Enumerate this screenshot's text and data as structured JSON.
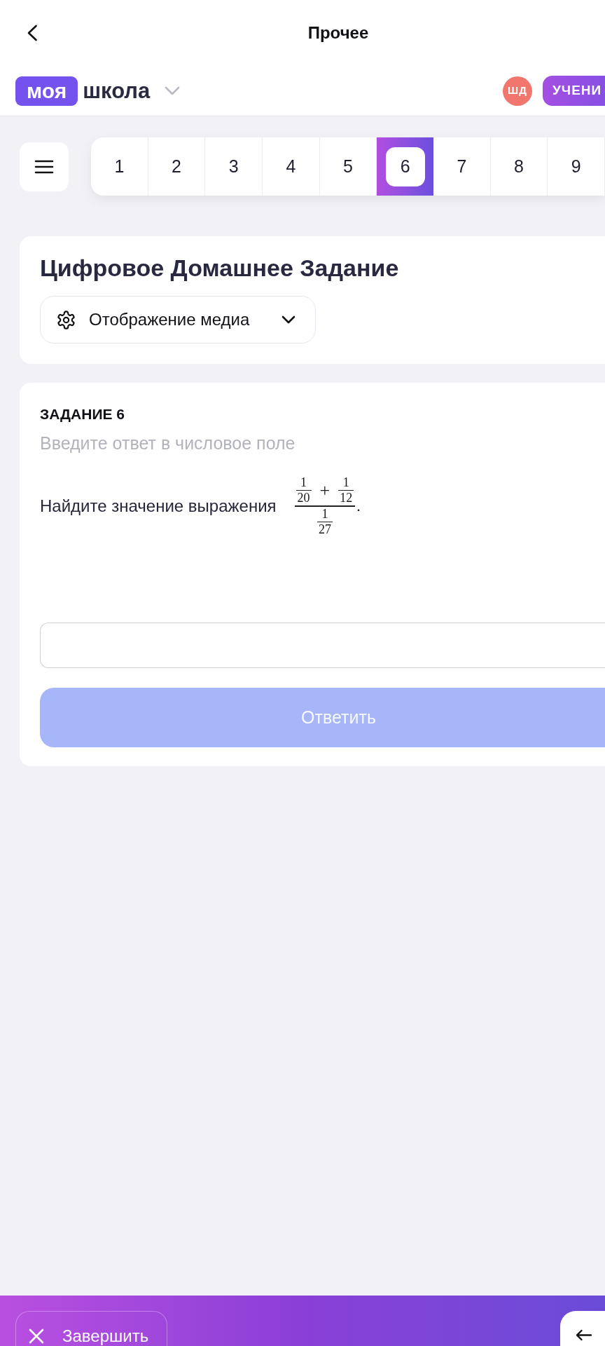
{
  "header": {
    "title": "Прочее"
  },
  "brand": {
    "badge": "моя",
    "name": "школа"
  },
  "user": {
    "initials": "ШД",
    "role": "УЧЕНИ"
  },
  "task_nav": [
    {
      "label": "1",
      "selected": false
    },
    {
      "label": "2",
      "selected": false
    },
    {
      "label": "3",
      "selected": false
    },
    {
      "label": "4",
      "selected": false
    },
    {
      "label": "5",
      "selected": false
    },
    {
      "label": "6",
      "selected": true
    },
    {
      "label": "7",
      "selected": false
    },
    {
      "label": "8",
      "selected": false
    },
    {
      "label": "9",
      "selected": false
    }
  ],
  "homework": {
    "title": "Цифровое Домашнее Задание",
    "media_dropdown": {
      "label": "Отображение медиа"
    }
  },
  "task": {
    "heading": "ЗАДАНИЕ 6",
    "instruction": "Введите ответ в числовое поле",
    "question": "Найдите значение выражения",
    "expression": {
      "numerator": [
        {
          "kind": "fraction",
          "numerator": "1",
          "denominator": "20"
        },
        {
          "kind": "operator",
          "symbol": "+"
        },
        {
          "kind": "fraction",
          "numerator": "1",
          "denominator": "12"
        }
      ],
      "denominator": [
        {
          "kind": "fraction",
          "numerator": "1",
          "denominator": "27"
        }
      ],
      "trailing": "."
    },
    "submit": {
      "label": "Ответить",
      "disabled": true
    }
  },
  "footer": {
    "finish": {
      "label": "Завершить"
    }
  }
}
